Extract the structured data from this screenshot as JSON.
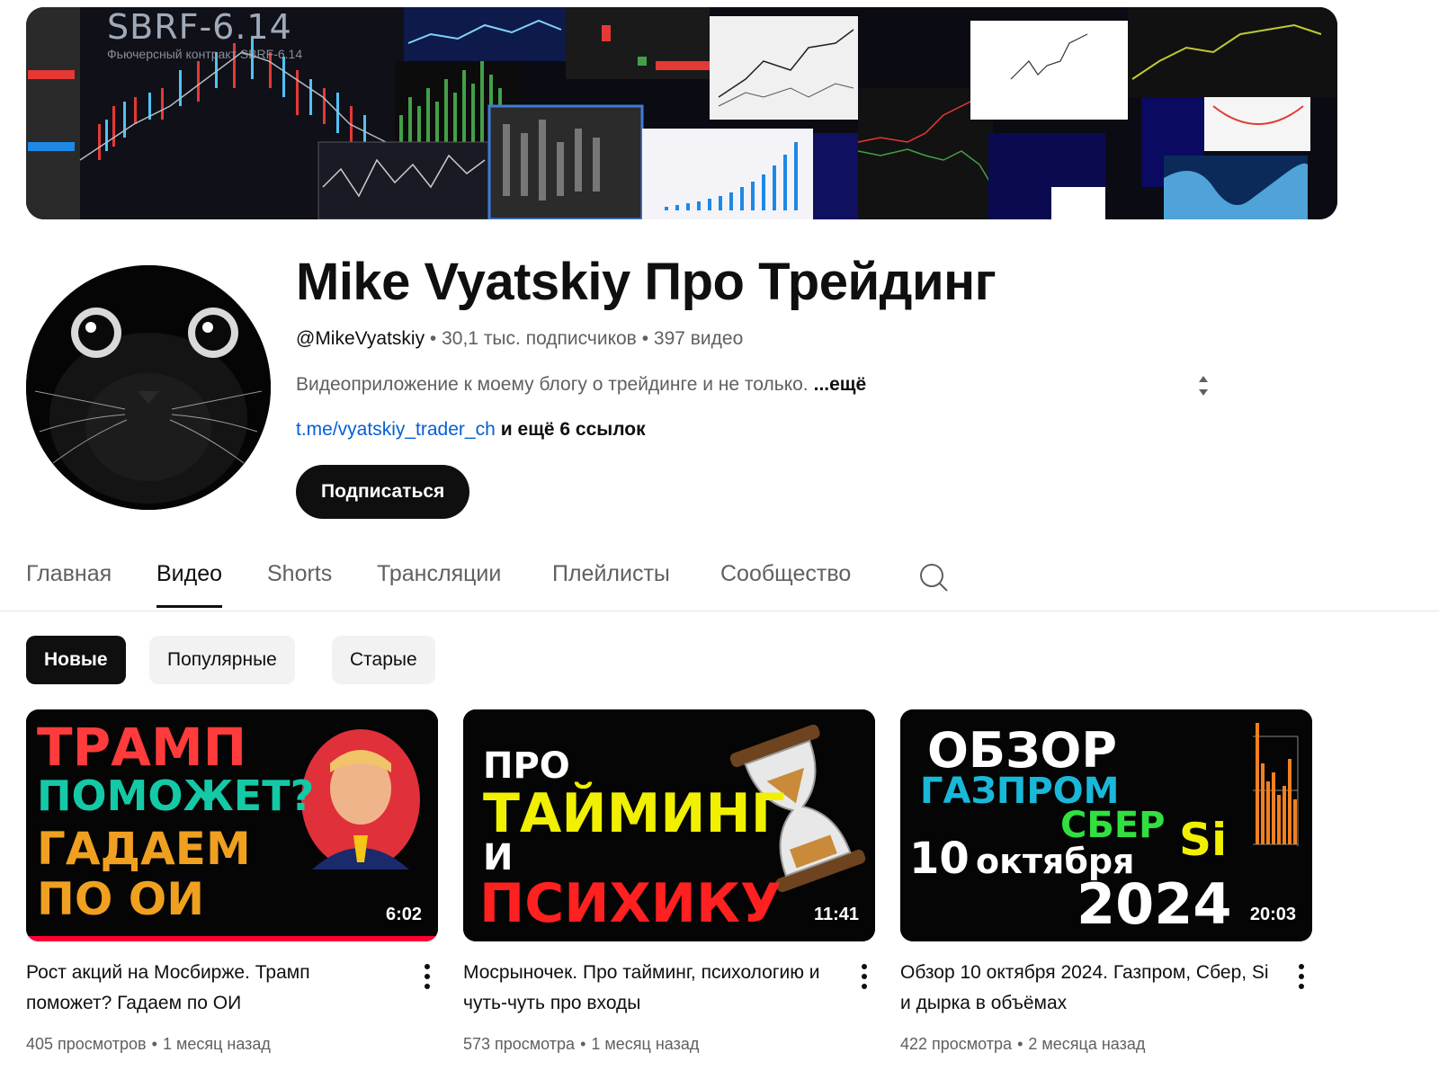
{
  "banner": {
    "ticker": "SBRF-6.14",
    "subtitle": "Фьючерсный контракт SBRF-6.14"
  },
  "channel": {
    "name": "Mike Vyatskiy Про Трейдинг",
    "handle": "@MikeVyatskiy",
    "subscribers": "30,1 тыс. подписчиков",
    "videos": "397 видео",
    "separator": "•",
    "description": "Видеоприложение к моему блогу о трейдинге и не только.",
    "more_label": "...ещё",
    "link": "t.me/vyatskiy_trader_ch",
    "more_links": "и ещё 6 ссылок",
    "subscribe_label": "Подписаться"
  },
  "tabs": [
    {
      "label": "Главная",
      "active": false
    },
    {
      "label": "Видео",
      "active": true
    },
    {
      "label": "Shorts",
      "active": false
    },
    {
      "label": "Трансляции",
      "active": false
    },
    {
      "label": "Плейлисты",
      "active": false
    },
    {
      "label": "Сообщество",
      "active": false
    }
  ],
  "chips": [
    {
      "label": "Новые",
      "active": true
    },
    {
      "label": "Популярные",
      "active": false
    },
    {
      "label": "Старые",
      "active": false
    }
  ],
  "videos": [
    {
      "title": "Рост акций на Мосбирже. Трамп поможет? Гадаем по ОИ",
      "views": "405 просмотров",
      "age": "1 месяц назад",
      "duration": "6:02",
      "watched_fraction": 1.0,
      "thumb_text": {
        "l1": "ТРАМП",
        "l2": "ПОМОЖЕТ?",
        "l3": "ГАДАЕМ",
        "l4": "ПО ОИ"
      }
    },
    {
      "title": "Мосрыночек. Про тайминг, психологию и чуть-чуть про входы",
      "views": "573 просмотра",
      "age": "1 месяц назад",
      "duration": "11:41",
      "watched_fraction": 0,
      "thumb_text": {
        "l1": "ПРО",
        "l2": "ТАЙМИНГ",
        "l3": "И",
        "l4": "ПСИХИКУ"
      }
    },
    {
      "title": "Обзор 10 октября 2024. Газпром, Сбер, Si и дырка в объёмах",
      "views": "422 просмотра",
      "age": "2 месяца назад",
      "duration": "20:03",
      "watched_fraction": 0,
      "thumb_text": {
        "l1": "ОБЗОР",
        "l2": "ГАЗПРОМ",
        "l3": "СБЕР",
        "l3b": "Si",
        "l4a": "10",
        "l4b": "октября",
        "l5": "2024"
      }
    }
  ],
  "icons": {
    "search": "search-icon",
    "more": "three-dots-icon",
    "expand": "sort-arrows-icon"
  },
  "colors": {
    "accent_red": "#ff0033",
    "link_blue": "#065fd4",
    "text_primary": "#0f0f0f",
    "text_secondary": "#606060"
  }
}
